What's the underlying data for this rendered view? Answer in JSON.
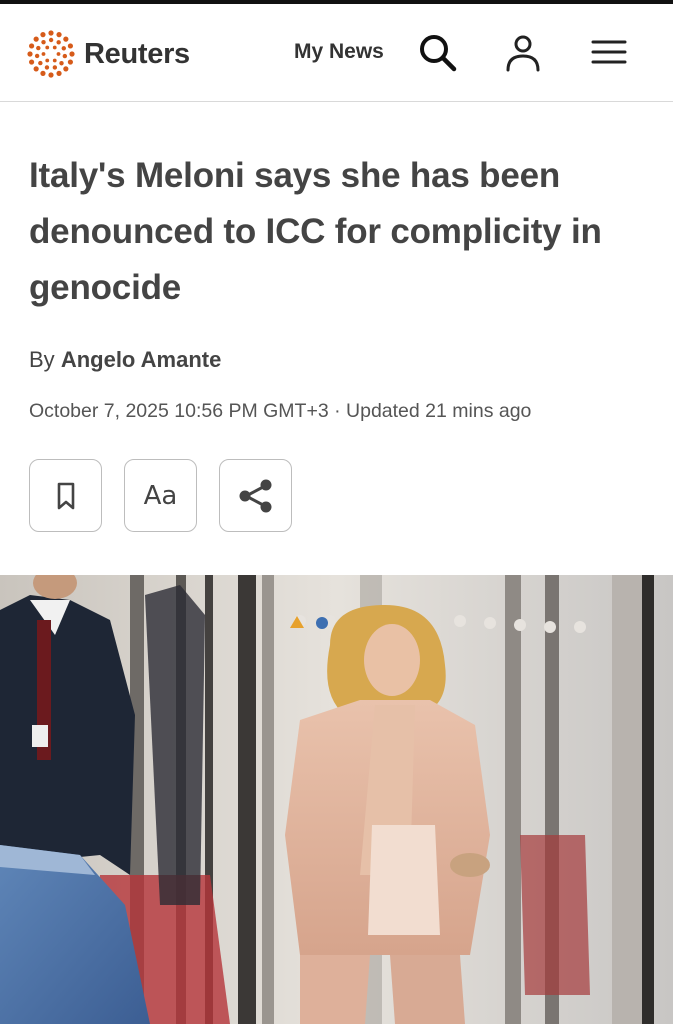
{
  "header": {
    "brand": "Reuters",
    "my_news_label": "My News",
    "icons": [
      "reuters-logo-icon",
      "search-icon",
      "user-icon",
      "menu-icon"
    ]
  },
  "article": {
    "headline": "Italy's Meloni says she has been denounced to ICC for complicity in genocide",
    "by_prefix": "By",
    "author": "Angelo Amante",
    "dateline": "October 7, 2025 10:56 PM GMT+3 · Updated 21 mins ago",
    "actions": {
      "bookmark_icon": "bookmark-icon",
      "text_size_label": "Aa",
      "share_icon": "share-icon"
    }
  },
  "colors": {
    "brand_orange": "#d65b1a",
    "text_dark": "#444444"
  }
}
